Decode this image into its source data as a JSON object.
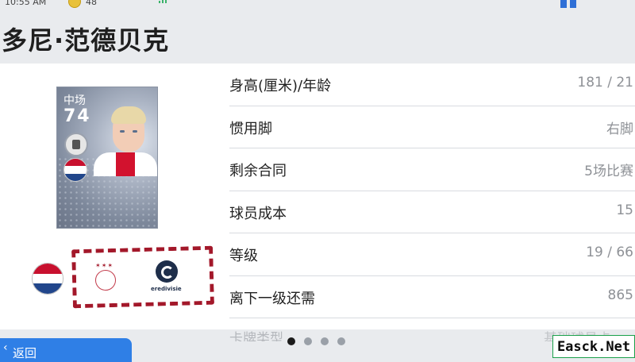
{
  "header": {
    "title": "多尼·范德贝克"
  },
  "statusbar": {
    "left_text": "10:55 AM",
    "coin_count": "48"
  },
  "card": {
    "position": "中场",
    "overall": "74"
  },
  "stats": {
    "rows": [
      {
        "label": "身高(厘米)/年龄",
        "value": "181 / 21"
      },
      {
        "label": "惯用脚",
        "value": "右脚"
      },
      {
        "label": "剩余合同",
        "value": "5场比赛"
      },
      {
        "label": "球员成本",
        "value": "15"
      },
      {
        "label": "等级",
        "value": "19 / 66"
      },
      {
        "label": "离下一级还需",
        "value": "865"
      }
    ],
    "faded_row": {
      "label": "卡牌类型",
      "value": "基础球员卡"
    }
  },
  "league": {
    "name_text": "eredivisie"
  },
  "footer": {
    "back_label": "返回",
    "page_count": 4,
    "active_page": 1
  },
  "watermark": {
    "text": "Easck.Net"
  },
  "colors": {
    "accent": "#2f7fe6",
    "dash_box": "#a3182a",
    "panel_bg": "#ffffff",
    "page_bg": "#e9ebee"
  }
}
